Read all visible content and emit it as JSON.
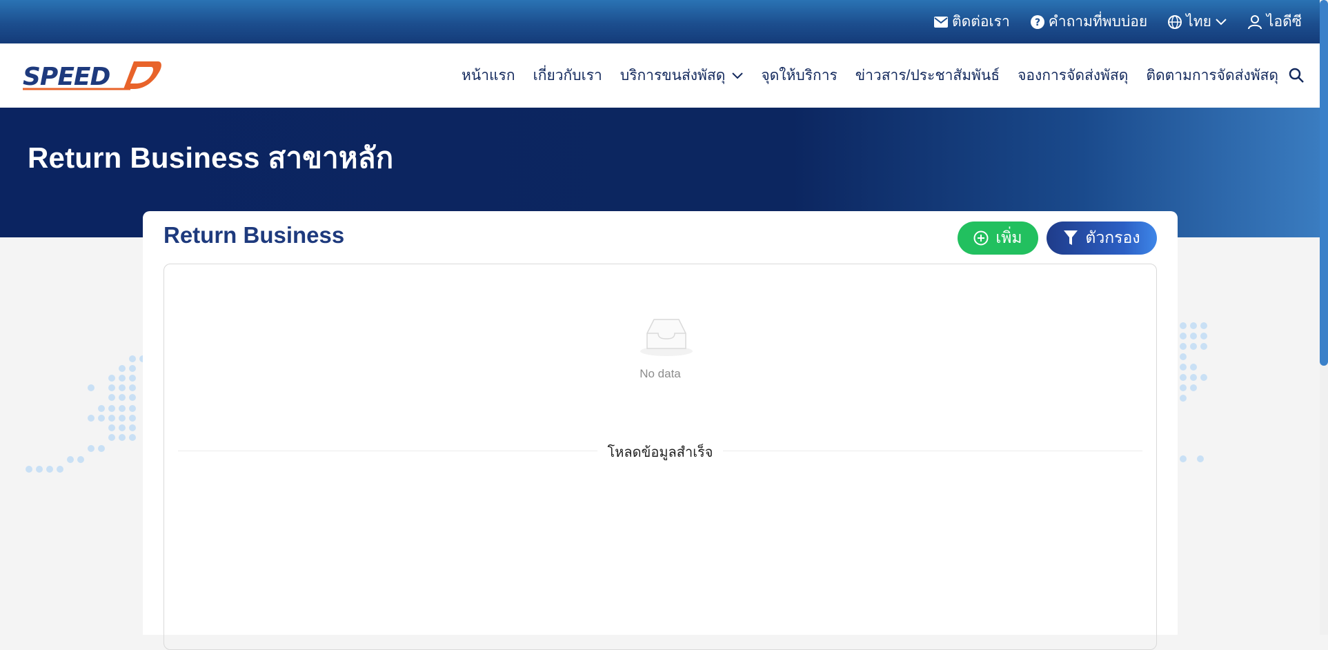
{
  "topbar": {
    "contact": "ติดต่อเรา",
    "faq": "คำถามที่พบบ่อย",
    "language": "ไทย",
    "user": "ไอดีซี"
  },
  "navbar": {
    "logo_text": "SPEED D",
    "items": [
      {
        "label": "หน้าแรก"
      },
      {
        "label": "เกี่ยวกับเรา"
      },
      {
        "label": "บริการขนส่งพัสดุ"
      },
      {
        "label": "จุดให้บริการ"
      },
      {
        "label": "ข่าวสาร/ประชาสัมพันธ์"
      },
      {
        "label": "จองการจัดส่งพัสดุ"
      },
      {
        "label": "ติดตามการจัดส่งพัสดุ"
      }
    ]
  },
  "hero": {
    "title": "Return Business สาขาหลัก"
  },
  "card": {
    "title": "Return Business",
    "add_label": "เพิ่ม",
    "filter_label": "ตัวกรอง",
    "empty_text": "No data",
    "status_text": "โหลดข้อมูลสำเร็จ"
  },
  "colors": {
    "primary": "#0b2461",
    "accent": "#22c05f",
    "title": "#1e3a7d"
  }
}
